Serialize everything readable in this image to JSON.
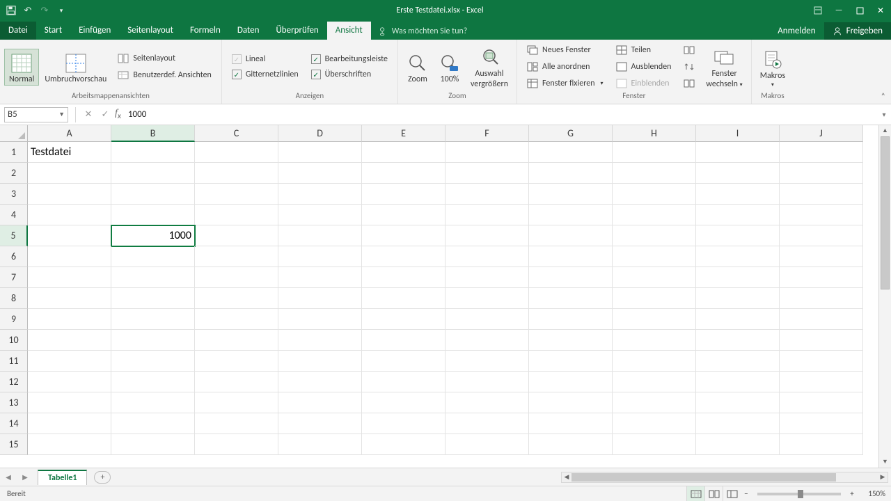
{
  "title": "Erste Testdatei.xlsx - Excel",
  "qat": {
    "save": "save",
    "undo": "undo",
    "redo": "redo"
  },
  "tabs": {
    "file": "Datei",
    "items": [
      "Start",
      "Einfügen",
      "Seitenlayout",
      "Formeln",
      "Daten",
      "Überprüfen",
      "Ansicht"
    ],
    "active": "Ansicht",
    "tell_placeholder": "Was möchten Sie tun?",
    "signin": "Anmelden",
    "share": "Freigeben"
  },
  "ribbon": {
    "views": {
      "normal": "Normal",
      "page_break": "Umbruchvorschau",
      "page_layout": "Seitenlayout",
      "custom_views": "Benutzerdef. Ansichten",
      "group": "Arbeitsmappenansichten"
    },
    "show": {
      "ruler": "Lineal",
      "formula_bar": "Bearbeitungsleiste",
      "gridlines": "Gitternetzlinien",
      "headings": "Überschriften",
      "group": "Anzeigen"
    },
    "zoom": {
      "zoom": "Zoom",
      "z100": "100%",
      "selection_line1": "Auswahl",
      "selection_line2": "vergrößern",
      "group": "Zoom"
    },
    "window": {
      "new": "Neues Fenster",
      "arrange": "Alle anordnen",
      "freeze": "Fenster fixieren",
      "split": "Teilen",
      "hide": "Ausblenden",
      "unhide": "Einblenden",
      "switch_line1": "Fenster",
      "switch_line2": "wechseln",
      "group": "Fenster"
    },
    "macros": {
      "label": "Makros",
      "group": "Makros"
    }
  },
  "formula_bar": {
    "name_box": "B5",
    "formula": "1000"
  },
  "grid": {
    "columns": [
      "A",
      "B",
      "C",
      "D",
      "E",
      "F",
      "G",
      "H",
      "I",
      "J"
    ],
    "rows": 15,
    "active": {
      "row": 5,
      "col": "B"
    },
    "cells": {
      "A1": {
        "value": "Testdatei",
        "align": "left"
      },
      "B5": {
        "value": "1000",
        "align": "right"
      }
    }
  },
  "sheet_tabs": {
    "active": "Tabelle1"
  },
  "status": {
    "ready": "Bereit",
    "zoom": "150%"
  }
}
